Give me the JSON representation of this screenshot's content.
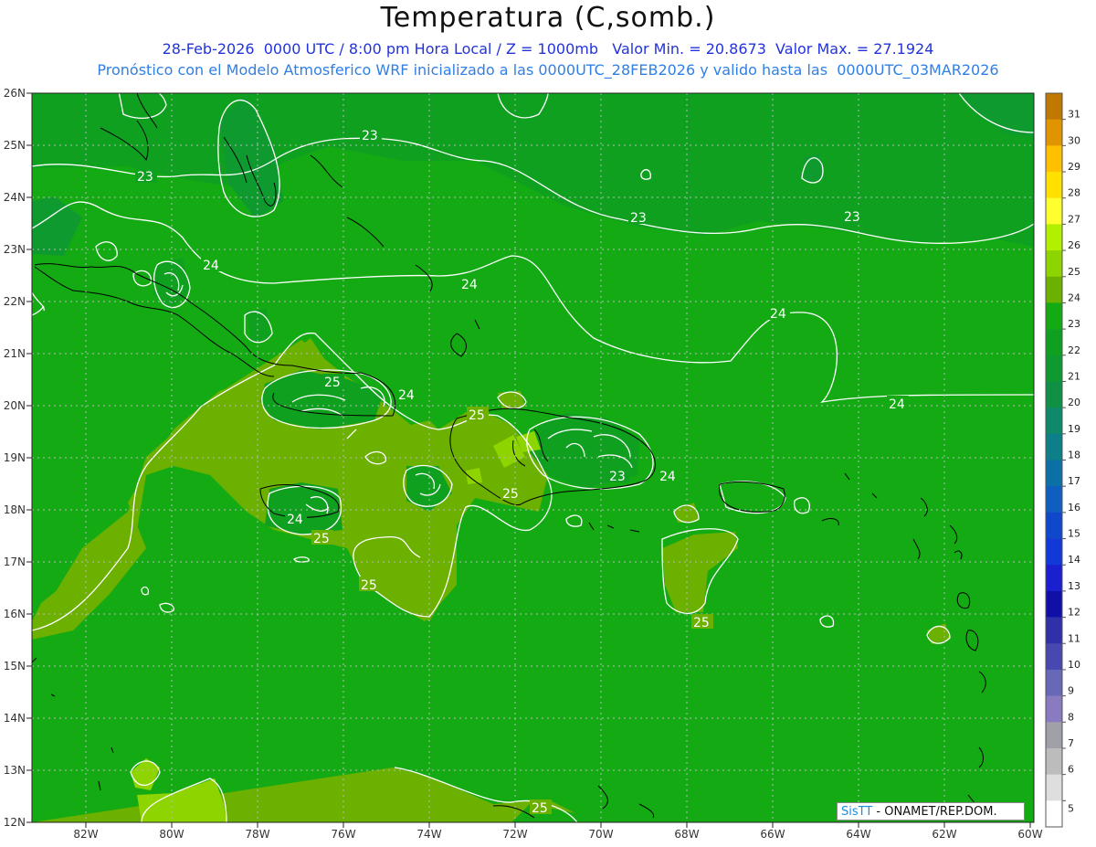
{
  "header": {
    "title": "Temperatura (C,somb.)",
    "subtitle_line1": "28-Feb-2026  0000 UTC / 8:00 pm Hora Local / Z = 1000mb   Valor Min. = 20.8673  Valor Max. = 27.1924",
    "subtitle_line2": "Pronóstico con el Modelo Atmosferico WRF inicializado a las 0000UTC_28FEB2026 y valido hasta las  0000UTC_03MAR2026"
  },
  "map": {
    "lon_labels": [
      "82W",
      "80W",
      "78W",
      "76W",
      "74W",
      "72W",
      "70W",
      "68W",
      "66W",
      "64W",
      "62W",
      "60W"
    ],
    "lat_labels": [
      "26N",
      "25N",
      "24N",
      "23N",
      "22N",
      "21N",
      "20N",
      "19N",
      "18N",
      "17N",
      "16N",
      "15N",
      "14N",
      "13N",
      "12N"
    ],
    "contour_labels": [
      "23",
      "23",
      "23",
      "23",
      "24",
      "24",
      "24",
      "24",
      "24",
      "24",
      "24",
      "25",
      "25",
      "25",
      "25",
      "25",
      "25",
      "23",
      "24",
      "25"
    ]
  },
  "colorbar": {
    "labels": [
      "31",
      "30",
      "29",
      "28",
      "27",
      "26",
      "25",
      "24",
      "23",
      "22",
      "21",
      "20",
      "19",
      "18",
      "17",
      "16",
      "15",
      "14",
      "13",
      "12",
      "11",
      "10",
      "9",
      "8",
      "7",
      "6",
      "5"
    ],
    "colors": [
      "#c07800",
      "#e09400",
      "#ffc000",
      "#ffe000",
      "#ffff30",
      "#b0f000",
      "#8ed400",
      "#6cb000",
      "#14aa14",
      "#10a020",
      "#0f9a30",
      "#0f9044",
      "#0e8a6a",
      "#0c7f88",
      "#0c6fa6",
      "#0f5ec0",
      "#1048cc",
      "#1238d8",
      "#1a20d0",
      "#1010a8",
      "#3030a8",
      "#4848b0",
      "#6868b8",
      "#8a7ac0",
      "#a0a0a8",
      "#bcbcbc",
      "#dedede",
      "#ffffff"
    ]
  },
  "credit": {
    "brand": "SisTT",
    "text": " - ONAMET/REP.DOM."
  }
}
